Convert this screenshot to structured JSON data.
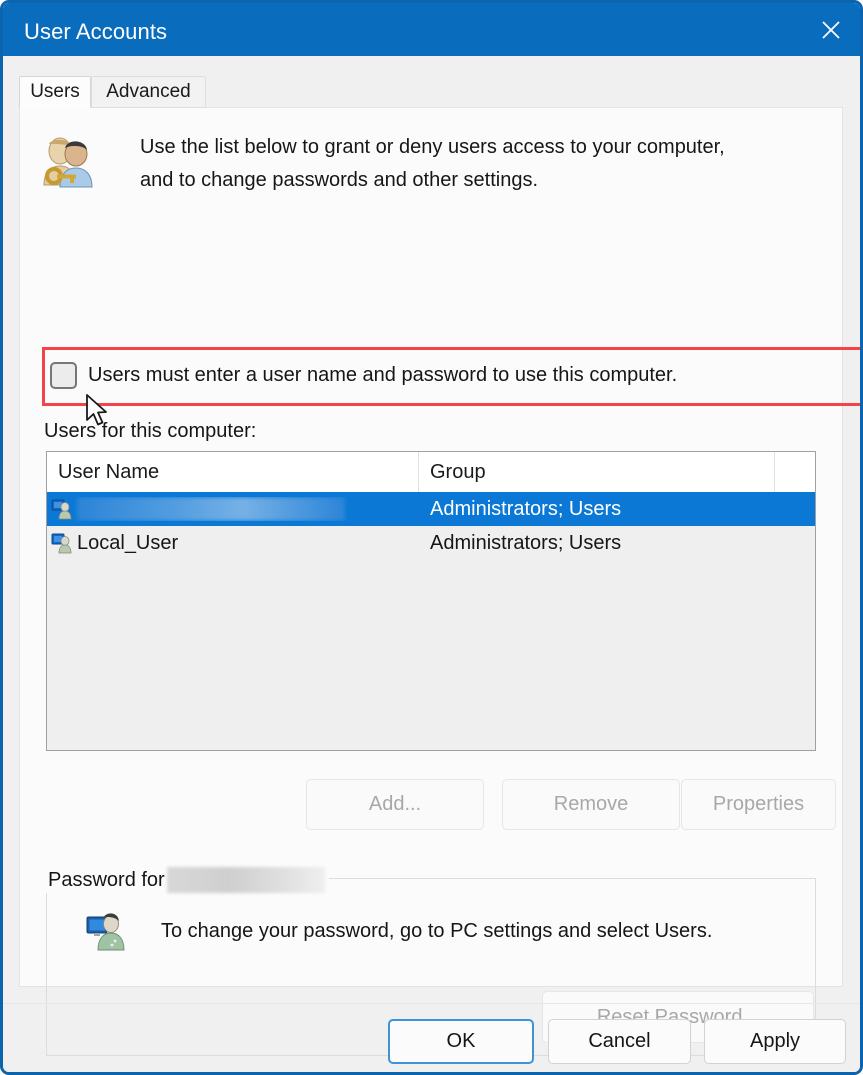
{
  "window": {
    "title": "User Accounts",
    "close_icon": "close-icon",
    "accent_color": "#0a6cbd",
    "border_color": "#0b64ad"
  },
  "tabs": [
    {
      "label": "Users",
      "selected": true
    },
    {
      "label": "Advanced",
      "selected": false
    }
  ],
  "header": {
    "icon": "users-with-key-icon",
    "line1": "Use the list below to grant or deny users access to your computer,",
    "line2": "and to change passwords and other settings."
  },
  "require_logon": {
    "label": "Users must enter a user name and password to use this computer.",
    "checked": false,
    "annotation_color": "#f4444a"
  },
  "list": {
    "label": "Users for this computer:",
    "columns": [
      "User Name",
      "Group"
    ],
    "rows": [
      {
        "user_name": "",
        "user_name_redacted": true,
        "group": "Administrators; Users",
        "selected": true
      },
      {
        "user_name": "Local_User",
        "user_name_redacted": false,
        "group": "Administrators; Users",
        "selected": false
      }
    ],
    "selection_color": "#0a78d4"
  },
  "actions": {
    "add_label": "Add...",
    "remove_label": "Remove",
    "properties_label": "Properties",
    "add_enabled": false,
    "remove_enabled": false,
    "properties_enabled": false
  },
  "password_group": {
    "title_prefix": "Password for",
    "title_value_redacted": true,
    "icon": "user-monitor-icon",
    "text": "To change your password, go to PC settings and select Users.",
    "reset_label": "Reset Password...",
    "reset_enabled": false
  },
  "footer": {
    "ok_label": "OK",
    "cancel_label": "Cancel",
    "apply_label": "Apply",
    "default_button": "OK"
  }
}
